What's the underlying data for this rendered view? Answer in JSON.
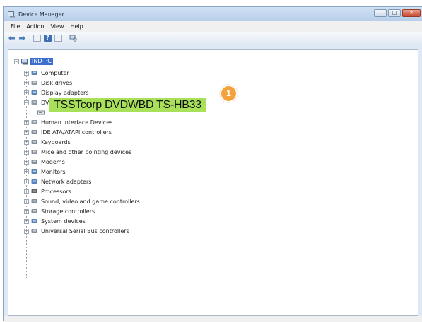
{
  "window": {
    "title": "Device Manager",
    "controls": {
      "minimize": "–",
      "maximize": "□",
      "close": "✕"
    }
  },
  "menu": [
    "File",
    "Action",
    "View",
    "Help"
  ],
  "toolbar": {
    "back_icon": "back-arrow-icon",
    "forward_icon": "forward-arrow-icon",
    "help_glyph": "?"
  },
  "tree": {
    "root": "IND-PC",
    "items": [
      {
        "label": "Computer",
        "icon": "computer-icon",
        "color": "#3d6db0"
      },
      {
        "label": "Disk drives",
        "icon": "disk-drive-icon",
        "color": "#7d8793"
      },
      {
        "label": "Display adapters",
        "icon": "display-adapter-icon",
        "color": "#3d6db0"
      },
      {
        "label": "DVD/CD-ROM drives",
        "icon": "dvd-drive-icon",
        "color": "#7d8793"
      },
      {
        "label": "Human Interface Devices",
        "icon": "hid-icon",
        "color": "#7d8793"
      },
      {
        "label": "IDE ATA/ATAPI controllers",
        "icon": "ide-controller-icon",
        "color": "#6f7a86"
      },
      {
        "label": "Keyboards",
        "icon": "keyboard-icon",
        "color": "#6f7a86"
      },
      {
        "label": "Mice and other pointing devices",
        "icon": "mouse-icon",
        "color": "#6f7a86"
      },
      {
        "label": "Modems",
        "icon": "modem-icon",
        "color": "#6f7a86"
      },
      {
        "label": "Monitors",
        "icon": "monitor-icon",
        "color": "#3d6db0"
      },
      {
        "label": "Network adapters",
        "icon": "network-adapter-icon",
        "color": "#3d6db0"
      },
      {
        "label": "Processors",
        "icon": "processor-icon",
        "color": "#444444"
      },
      {
        "label": "Sound, video and game controllers",
        "icon": "speaker-icon",
        "color": "#6f7a86"
      },
      {
        "label": "Storage controllers",
        "icon": "storage-controller-icon",
        "color": "#6f7a86"
      },
      {
        "label": "System devices",
        "icon": "system-device-icon",
        "color": "#3d6db0"
      },
      {
        "label": "Universal Serial Bus controllers",
        "icon": "usb-icon",
        "color": "#6f7a86"
      }
    ],
    "expanded_child": {
      "label": "TSSTcorp DVDWBD TS-HB33",
      "icon": "dvd-device-icon"
    }
  },
  "callout": {
    "text": "TSSTcorp DVDWBD TS-HB33",
    "badge": "1",
    "highlight_color": "#a8e05a",
    "badge_color": "#f4a23c"
  }
}
